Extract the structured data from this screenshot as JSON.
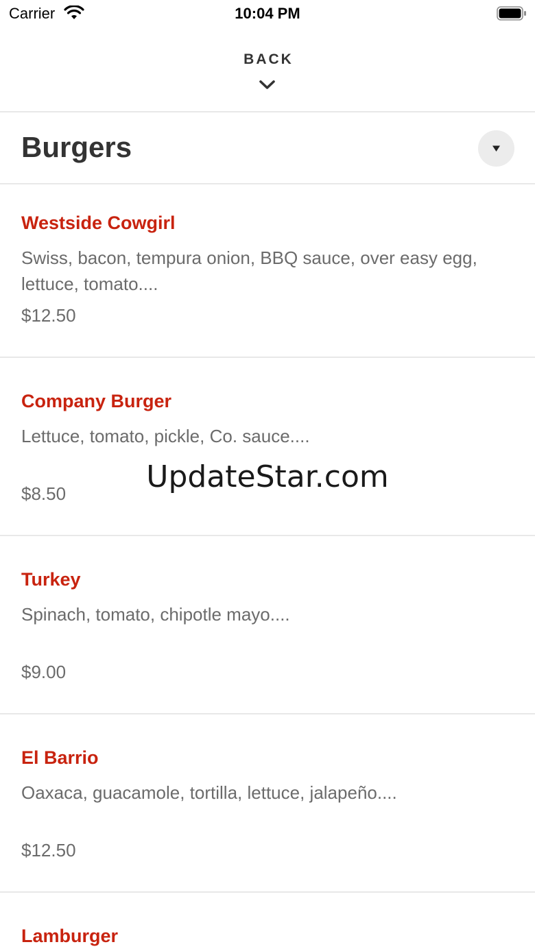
{
  "status_bar": {
    "carrier": "Carrier",
    "time": "10:04 PM",
    "wifi_icon": "wifi-icon",
    "battery_icon": "battery-icon"
  },
  "nav": {
    "back_label": "BACK",
    "chevron_icon": "chevron-down-icon"
  },
  "category": {
    "title": "Burgers",
    "dropdown_icon": "caret-down-icon"
  },
  "items": [
    {
      "name": "Westside Cowgirl",
      "description": "Swiss, bacon, tempura onion, BBQ sauce, over easy egg, lettuce, tomato....",
      "price": "$12.50"
    },
    {
      "name": "Company Burger",
      "description": "Lettuce, tomato, pickle, Co. sauce....",
      "price": "$8.50"
    },
    {
      "name": "Turkey",
      "description": "Spinach, tomato, chipotle mayo....",
      "price": "$9.00"
    },
    {
      "name": "El Barrio",
      "description": "Oaxaca, guacamole, tortilla, lettuce, jalapeño....",
      "price": "$12.50"
    },
    {
      "name": "Lamburger",
      "description": "",
      "price": ""
    }
  ],
  "watermark": "UpdateStar.com",
  "colors": {
    "item_name": "#c8230f",
    "text_secondary": "#6b6b6b",
    "title": "#333333",
    "divider": "#e8e8e8"
  }
}
